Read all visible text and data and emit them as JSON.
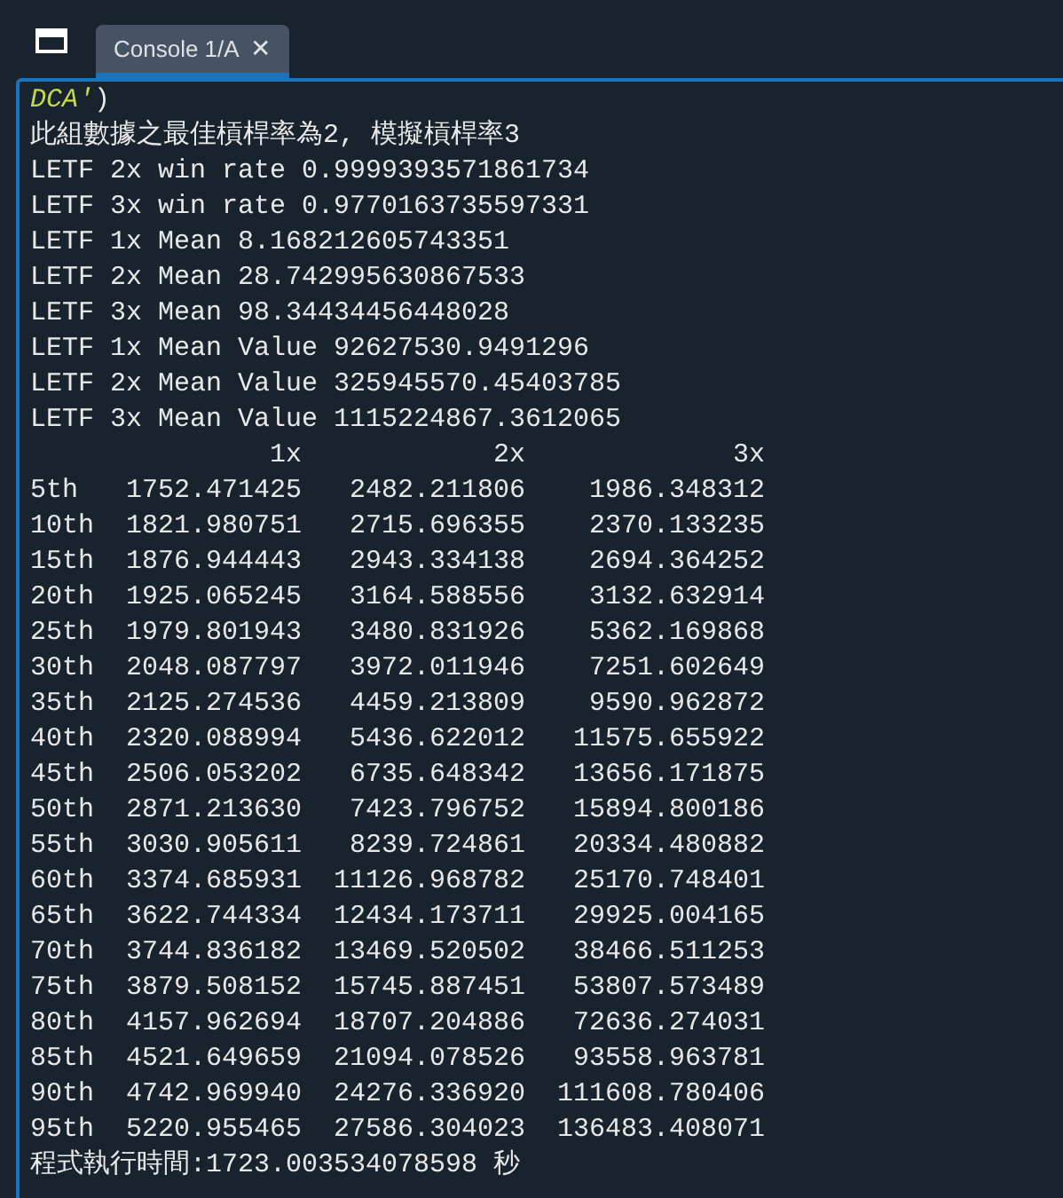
{
  "tabs": [
    {
      "label": "Console 1/A",
      "close": "✕",
      "selected": true
    }
  ],
  "console": {
    "first_line": [
      {
        "text": "DCA'",
        "kind": "string"
      },
      {
        "text": ")",
        "kind": "plain"
      }
    ],
    "lines": [
      "此組數據之最佳槓桿率為2, 模擬槓桿率3",
      "LETF 2x win rate 0.9999393571861734",
      "LETF 3x win rate 0.9770163735597331",
      "LETF 1x Mean 8.168212605743351",
      "LETF 2x Mean 28.742995630867533",
      "LETF 3x Mean 98.34434456448028",
      "LETF 1x Mean Value 92627530.9491296",
      "LETF 2x Mean Value 325945570.45403785",
      "LETF 3x Mean Value 1115224867.3612065"
    ],
    "table": {
      "columns": [
        "",
        "1x",
        "2x",
        "3x"
      ],
      "rows": [
        [
          "5th",
          "1752.471425",
          "2482.211806",
          "1986.348312"
        ],
        [
          "10th",
          "1821.980751",
          "2715.696355",
          "2370.133235"
        ],
        [
          "15th",
          "1876.944443",
          "2943.334138",
          "2694.364252"
        ],
        [
          "20th",
          "1925.065245",
          "3164.588556",
          "3132.632914"
        ],
        [
          "25th",
          "1979.801943",
          "3480.831926",
          "5362.169868"
        ],
        [
          "30th",
          "2048.087797",
          "3972.011946",
          "7251.602649"
        ],
        [
          "35th",
          "2125.274536",
          "4459.213809",
          "9590.962872"
        ],
        [
          "40th",
          "2320.088994",
          "5436.622012",
          "11575.655922"
        ],
        [
          "45th",
          "2506.053202",
          "6735.648342",
          "13656.171875"
        ],
        [
          "50th",
          "2871.213630",
          "7423.796752",
          "15894.800186"
        ],
        [
          "55th",
          "3030.905611",
          "8239.724861",
          "20334.480882"
        ],
        [
          "60th",
          "3374.685931",
          "11126.968782",
          "25170.748401"
        ],
        [
          "65th",
          "3622.744334",
          "12434.173711",
          "29925.004165"
        ],
        [
          "70th",
          "3744.836182",
          "13469.520502",
          "38466.511253"
        ],
        [
          "75th",
          "3879.508152",
          "15745.887451",
          "53807.573489"
        ],
        [
          "80th",
          "4157.962694",
          "18707.204886",
          "72636.274031"
        ],
        [
          "85th",
          "4521.649659",
          "21094.078526",
          "93558.963781"
        ],
        [
          "90th",
          "4742.969940",
          "24276.336920",
          "111608.780406"
        ],
        [
          "95th",
          "5220.955465",
          "27586.304023",
          "136483.408071"
        ]
      ]
    },
    "footer": "程式執行時間:1723.003534078598 秒"
  }
}
